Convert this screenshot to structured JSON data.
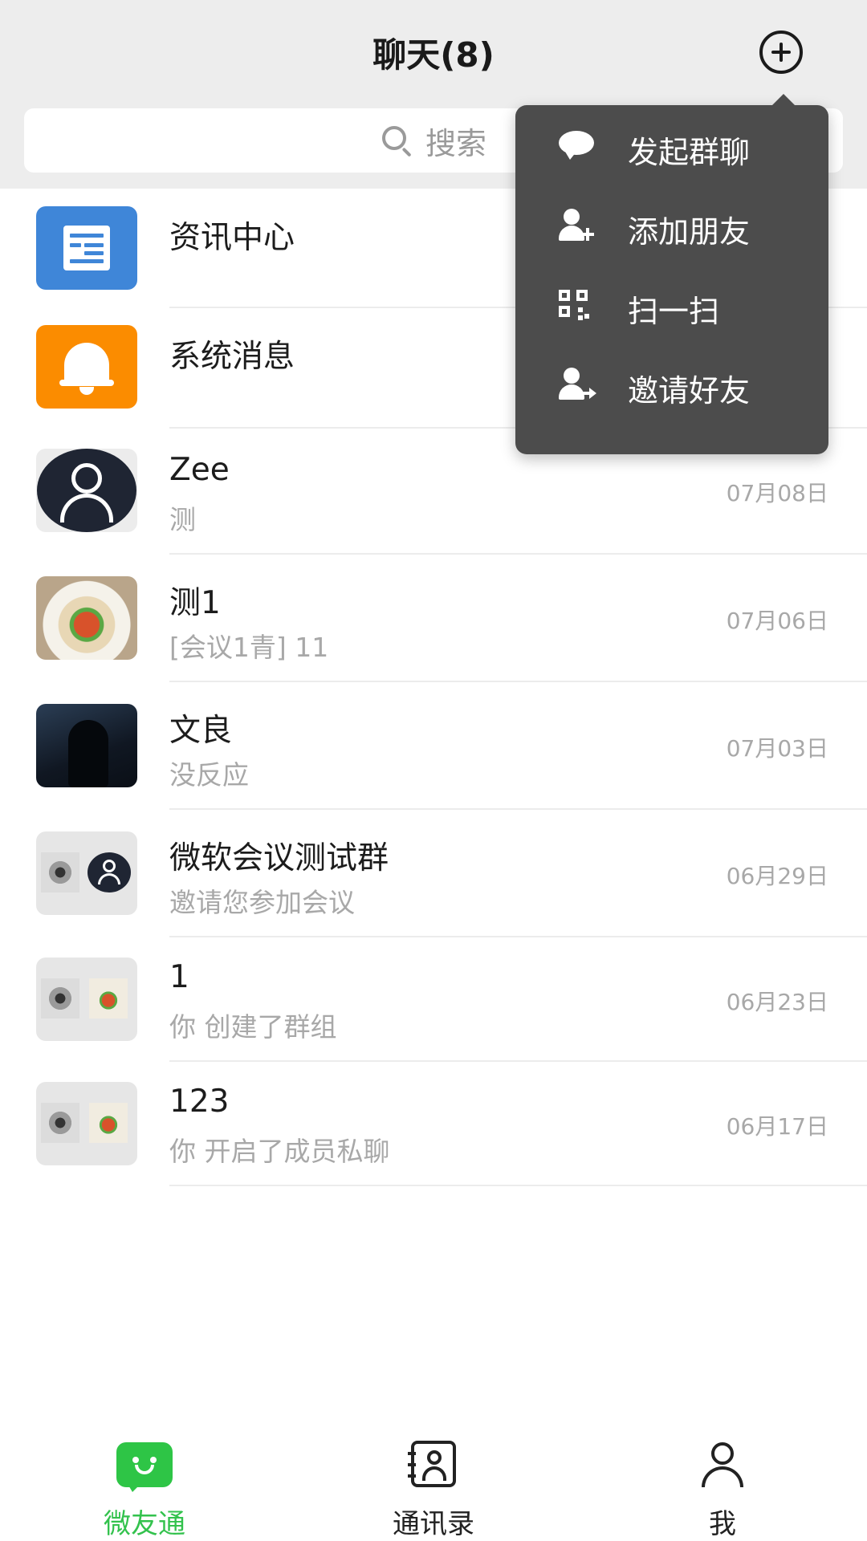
{
  "header": {
    "title": "聊天(8)",
    "add_icon": "plus-circle-icon"
  },
  "search": {
    "placeholder": "搜索",
    "icon": "search-icon"
  },
  "popup_menu": {
    "items": [
      {
        "label": "发起群聊",
        "icon": "chat-bubble-icon"
      },
      {
        "label": "添加朋友",
        "icon": "add-person-icon"
      },
      {
        "label": "扫一扫",
        "icon": "qr-code-icon"
      },
      {
        "label": "邀请好友",
        "icon": "invite-person-icon"
      }
    ]
  },
  "conversations": [
    {
      "name": "资讯中心",
      "preview": "",
      "date": "",
      "avatar": "news-icon",
      "avatar_color": "#3f86d8"
    },
    {
      "name": "系统消息",
      "preview": "",
      "date": "",
      "avatar": "bell-icon",
      "avatar_color": "#fb8c00"
    },
    {
      "name": "Zee",
      "preview": "测",
      "date": "07月08日",
      "avatar": "user-icon"
    },
    {
      "name": "测1",
      "preview": "[会议1青] 11",
      "date": "07月06日",
      "avatar": "photo-food"
    },
    {
      "name": "文良",
      "preview": "没反应",
      "date": "07月03日",
      "avatar": "photo-dark"
    },
    {
      "name": "微软会议测试群",
      "preview": "邀请您参加会议",
      "date": "06月29日",
      "avatar": "group-avatar"
    },
    {
      "name": "1",
      "preview": "你 创建了群组",
      "date": "06月23日",
      "avatar": "group-avatar"
    },
    {
      "name": "123",
      "preview": "你 开启了成员私聊",
      "date": "06月17日",
      "avatar": "group-avatar"
    }
  ],
  "tabbar": {
    "tabs": [
      {
        "label": "微友通",
        "icon": "chat-tab-icon",
        "active": true
      },
      {
        "label": "通讯录",
        "icon": "contacts-tab-icon",
        "active": false
      },
      {
        "label": "我",
        "icon": "me-tab-icon",
        "active": false
      }
    ],
    "active_color": "#33c24d"
  }
}
